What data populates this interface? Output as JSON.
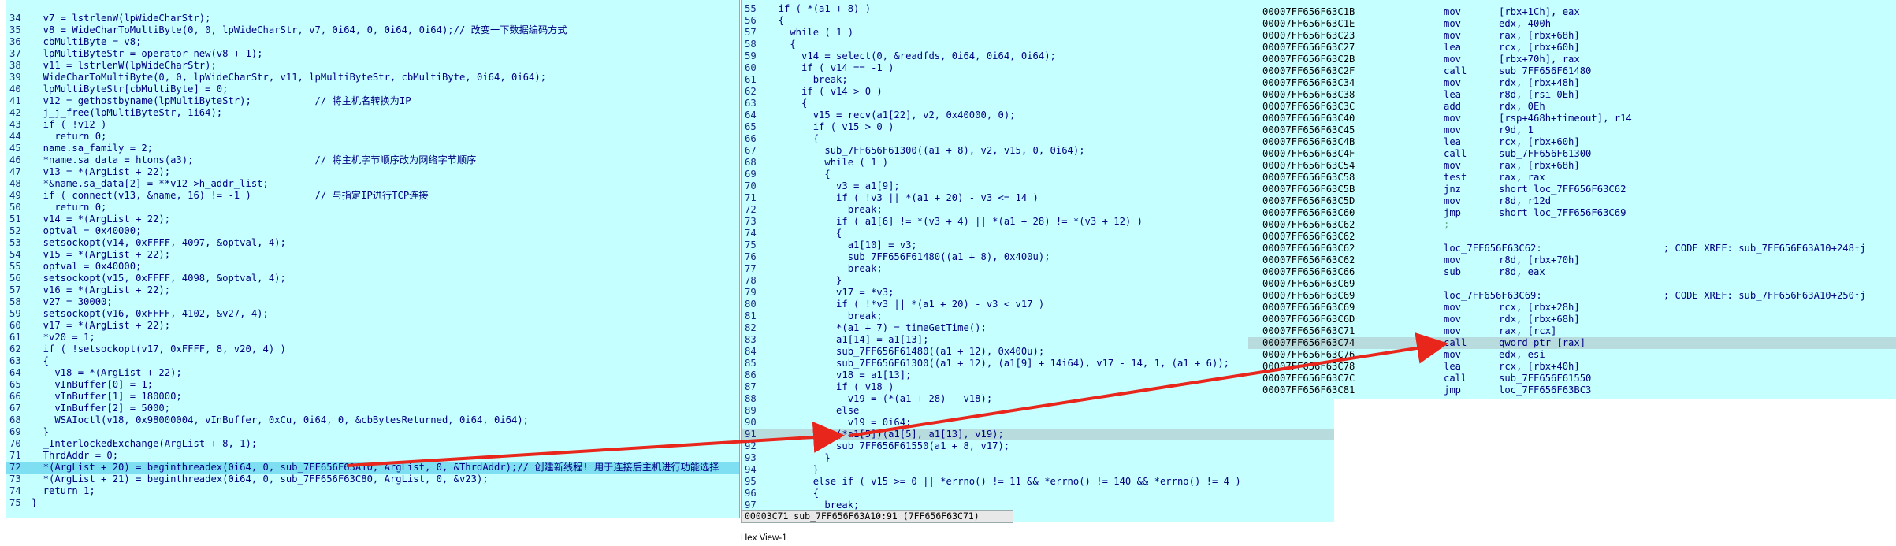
{
  "left_pane": {
    "lines": [
      {
        "n": "34",
        "t": "  v7 = lstrlenW(lpWideCharStr);"
      },
      {
        "n": "35",
        "t": "  v8 = WideCharToMultiByte(0, 0, lpWideCharStr, v7, 0i64, 0, 0i64, 0i64);// 改变一下数据编码方式"
      },
      {
        "n": "36",
        "t": "  cbMultiByte = v8;"
      },
      {
        "n": "37",
        "t": "  lpMultiByteStr = operator new(v8 + 1);"
      },
      {
        "n": "38",
        "t": "  v11 = lstrlenW(lpWideCharStr);"
      },
      {
        "n": "39",
        "t": "  WideCharToMultiByte(0, 0, lpWideCharStr, v11, lpMultiByteStr, cbMultiByte, 0i64, 0i64);"
      },
      {
        "n": "40",
        "t": "  lpMultiByteStr[cbMultiByte] = 0;"
      },
      {
        "n": "41",
        "t": "  v12 = gethostbyname(lpMultiByteStr);           // 将主机名转换为IP"
      },
      {
        "n": "42",
        "t": "  j_j_free(lpMultiByteStr, 1i64);"
      },
      {
        "n": "43",
        "t": "  if ( !v12 )"
      },
      {
        "n": "44",
        "t": "    return 0;"
      },
      {
        "n": "45",
        "t": "  name.sa_family = 2;"
      },
      {
        "n": "46",
        "t": "  *name.sa_data = htons(a3);                     // 将主机字节顺序改为网络字节顺序"
      },
      {
        "n": "47",
        "t": "  v13 = *(ArgList + 22);"
      },
      {
        "n": "48",
        "t": "  *&name.sa_data[2] = **v12->h_addr_list;"
      },
      {
        "n": "49",
        "t": "  if ( connect(v13, &name, 16) != -1 )           // 与指定IP进行TCP连接"
      },
      {
        "n": "50",
        "t": "    return 0;"
      },
      {
        "n": "51",
        "t": "  v14 = *(ArgList + 22);"
      },
      {
        "n": "52",
        "t": "  optval = 0x40000;"
      },
      {
        "n": "53",
        "t": "  setsockopt(v14, 0xFFFF, 4097, &optval, 4);"
      },
      {
        "n": "54",
        "t": "  v15 = *(ArgList + 22);"
      },
      {
        "n": "55",
        "t": "  optval = 0x40000;"
      },
      {
        "n": "56",
        "t": "  setsockopt(v15, 0xFFFF, 4098, &optval, 4);"
      },
      {
        "n": "57",
        "t": "  v16 = *(ArgList + 22);"
      },
      {
        "n": "58",
        "t": "  v27 = 30000;"
      },
      {
        "n": "59",
        "t": "  setsockopt(v16, 0xFFFF, 4102, &v27, 4);"
      },
      {
        "n": "60",
        "t": "  v17 = *(ArgList + 22);"
      },
      {
        "n": "61",
        "t": "  *v20 = 1;"
      },
      {
        "n": "62",
        "t": "  if ( !setsockopt(v17, 0xFFFF, 8, v20, 4) )"
      },
      {
        "n": "63",
        "t": "  {"
      },
      {
        "n": "64",
        "t": "    v18 = *(ArgList + 22);"
      },
      {
        "n": "65",
        "t": "    vInBuffer[0] = 1;"
      },
      {
        "n": "66",
        "t": "    vInBuffer[1] = 180000;"
      },
      {
        "n": "67",
        "t": "    vInBuffer[2] = 5000;"
      },
      {
        "n": "68",
        "t": "    WSAIoctl(v18, 0x98000004, vInBuffer, 0xCu, 0i64, 0, &cbBytesReturned, 0i64, 0i64);"
      },
      {
        "n": "69",
        "t": "  }"
      },
      {
        "n": "70",
        "t": "  _InterlockedExchange(ArgList + 8, 1);"
      },
      {
        "n": "71",
        "t": "  ThrdAddr = 0;"
      },
      {
        "n": "72",
        "t": "  *(ArgList + 20) = beginthreadex(0i64, 0, sub_7FF656F63A10, ArgList, 0, &ThrdAddr);// 创建新线程! 用于连接后主机进行功能选择"
      },
      {
        "n": "73",
        "t": "  *(ArgList + 21) = beginthreadex(0i64, 0, sub_7FF656F63C80, ArgList, 0, &v23);"
      },
      {
        "n": "74",
        "t": "  return 1;"
      },
      {
        "n": "75",
        "t": "}"
      }
    ]
  },
  "mid_pane": {
    "lines": [
      {
        "n": "55",
        "t": "  if ( *(a1 + 8) )"
      },
      {
        "n": "56",
        "t": "  {"
      },
      {
        "n": "57",
        "t": "    while ( 1 )"
      },
      {
        "n": "58",
        "t": "    {"
      },
      {
        "n": "59",
        "t": "      v14 = select(0, &readfds, 0i64, 0i64, 0i64);"
      },
      {
        "n": "60",
        "t": "      if ( v14 == -1 )"
      },
      {
        "n": "61",
        "t": "        break;"
      },
      {
        "n": "62",
        "t": "      if ( v14 > 0 )"
      },
      {
        "n": "63",
        "t": "      {"
      },
      {
        "n": "64",
        "t": "        v15 = recv(a1[22], v2, 0x40000, 0);"
      },
      {
        "n": "65",
        "t": "        if ( v15 > 0 )"
      },
      {
        "n": "66",
        "t": "        {"
      },
      {
        "n": "67",
        "t": "          sub_7FF656F61300((a1 + 8), v2, v15, 0, 0i64);"
      },
      {
        "n": "68",
        "t": "          while ( 1 )"
      },
      {
        "n": "69",
        "t": "          {"
      },
      {
        "n": "70",
        "t": "            v3 = a1[9];"
      },
      {
        "n": "71",
        "t": "            if ( !v3 || *(a1 + 20) - v3 <= 14 )"
      },
      {
        "n": "72",
        "t": "              break;"
      },
      {
        "n": "73",
        "t": "            if ( a1[6] != *(v3 + 4) || *(a1 + 28) != *(v3 + 12) )"
      },
      {
        "n": "74",
        "t": "            {"
      },
      {
        "n": "75",
        "t": "              a1[10] = v3;"
      },
      {
        "n": "76",
        "t": "              sub_7FF656F61480((a1 + 8), 0x400u);"
      },
      {
        "n": "77",
        "t": "              break;"
      },
      {
        "n": "78",
        "t": "            }"
      },
      {
        "n": "79",
        "t": "            v17 = *v3;"
      },
      {
        "n": "80",
        "t": "            if ( !*v3 || *(a1 + 20) - v3 < v17 )"
      },
      {
        "n": "81",
        "t": "              break;"
      },
      {
        "n": "82",
        "t": "            *(a1 + 7) = timeGetTime();"
      },
      {
        "n": "83",
        "t": "            a1[14] = a1[13];"
      },
      {
        "n": "84",
        "t": "            sub_7FF656F61480((a1 + 12), 0x400u);"
      },
      {
        "n": "85",
        "t": "            sub_7FF656F61300((a1 + 12), (a1[9] + 14i64), v17 - 14, 1, (a1 + 6));"
      },
      {
        "n": "86",
        "t": "            v18 = a1[13];"
      },
      {
        "n": "87",
        "t": "            if ( v18 )"
      },
      {
        "n": "88",
        "t": "              v19 = (*(a1 + 28) - v18);"
      },
      {
        "n": "89",
        "t": "            else"
      },
      {
        "n": "90",
        "t": "              v19 = 0i64;"
      },
      {
        "n": "91",
        "t": "            (*a1[5])(a1[5], a1[13], v19);"
      },
      {
        "n": "92",
        "t": "            sub_7FF656F61550(a1 + 8, v17);"
      },
      {
        "n": "93",
        "t": "          }"
      },
      {
        "n": "94",
        "t": "        }"
      },
      {
        "n": "95",
        "t": "        else if ( v15 >= 0 || *errno() != 11 && *errno() != 140 && *errno() != 4 )"
      },
      {
        "n": "96",
        "t": "        {"
      },
      {
        "n": "97",
        "t": "          break;"
      }
    ],
    "status_bar": "00003C71 sub_7FF656F63A10:91 (7FF656F63C71)",
    "footer": "Hex View-1"
  },
  "right_pane": {
    "lines": [
      {
        "a": "00007FF656F63C1B",
        "m": "mov",
        "o": "[rbx+1Ch], eax"
      },
      {
        "a": "00007FF656F63C1E",
        "m": "mov",
        "o": "edx, 400h"
      },
      {
        "a": "00007FF656F63C23",
        "m": "mov",
        "o": "rax, [rbx+68h]"
      },
      {
        "a": "00007FF656F63C27",
        "m": "lea",
        "o": "rcx, [rbx+60h]"
      },
      {
        "a": "00007FF656F63C2B",
        "m": "mov",
        "o": "[rbx+70h], rax"
      },
      {
        "a": "00007FF656F63C2F",
        "m": "call",
        "o": "sub_7FF656F61480"
      },
      {
        "a": "00007FF656F63C34",
        "m": "mov",
        "o": "rdx, [rbx+48h]"
      },
      {
        "a": "00007FF656F63C38",
        "m": "lea",
        "o": "r8d, [rsi-0Eh]"
      },
      {
        "a": "00007FF656F63C3C",
        "m": "add",
        "o": "rdx, 0Eh"
      },
      {
        "a": "00007FF656F63C40",
        "m": "mov",
        "o": "[rsp+468h+timeout], r14"
      },
      {
        "a": "00007FF656F63C45",
        "m": "mov",
        "o": "r9d, 1"
      },
      {
        "a": "00007FF656F63C4B",
        "m": "lea",
        "o": "rcx, [rbx+60h]"
      },
      {
        "a": "00007FF656F63C4F",
        "m": "call",
        "o": "sub_7FF656F61300"
      },
      {
        "a": "00007FF656F63C54",
        "m": "mov",
        "o": "rax, [rbx+68h]"
      },
      {
        "a": "00007FF656F63C58",
        "m": "test",
        "o": "rax, rax"
      },
      {
        "a": "00007FF656F63C5B",
        "m": "jnz",
        "o": "short loc_7FF656F63C62"
      },
      {
        "a": "00007FF656F63C5D",
        "m": "mov",
        "o": "r8d, r12d"
      },
      {
        "a": "00007FF656F63C60",
        "m": "jmp",
        "o": "short loc_7FF656F63C69"
      },
      {
        "a": "00007FF656F63C62",
        "m": "; --------------------------------------------------------------------------",
        "o": ""
      },
      {
        "a": "00007FF656F63C62",
        "m": "",
        "o": ""
      },
      {
        "a": "00007FF656F63C62",
        "m": "loc_7FF656F63C62:",
        "o": "                     ; CODE XREF: sub_7FF656F63A10+248↑j"
      },
      {
        "a": "00007FF656F63C62",
        "m": "mov",
        "o": "r8d, [rbx+70h]"
      },
      {
        "a": "00007FF656F63C66",
        "m": "sub",
        "o": "r8d, eax"
      },
      {
        "a": "00007FF656F63C69",
        "m": "",
        "o": ""
      },
      {
        "a": "00007FF656F63C69",
        "m": "loc_7FF656F63C69:",
        "o": "                     ; CODE XREF: sub_7FF656F63A10+250↑j"
      },
      {
        "a": "00007FF656F63C69",
        "m": "mov",
        "o": "rcx, [rbx+28h]"
      },
      {
        "a": "00007FF656F63C6D",
        "m": "mov",
        "o": "rdx, [rbx+68h]"
      },
      {
        "a": "00007FF656F63C71",
        "m": "mov",
        "o": "rax, [rcx]"
      },
      {
        "a": "00007FF656F63C74",
        "m": "call",
        "o": "qword ptr [rax]"
      },
      {
        "a": "00007FF656F63C76",
        "m": "mov",
        "o": "edx, esi"
      },
      {
        "a": "00007FF656F63C78",
        "m": "lea",
        "o": "rcx, [rbx+40h]"
      },
      {
        "a": "00007FF656F63C7C",
        "m": "call",
        "o": "sub_7FF656F61550"
      },
      {
        "a": "00007FF656F63C81",
        "m": "jmp",
        "o": "loc_7FF656F63BC3"
      }
    ]
  },
  "colors": {
    "pane_bg": "#c5ffff",
    "highlight": "#7fdff2",
    "arrow": "#e8261c"
  }
}
